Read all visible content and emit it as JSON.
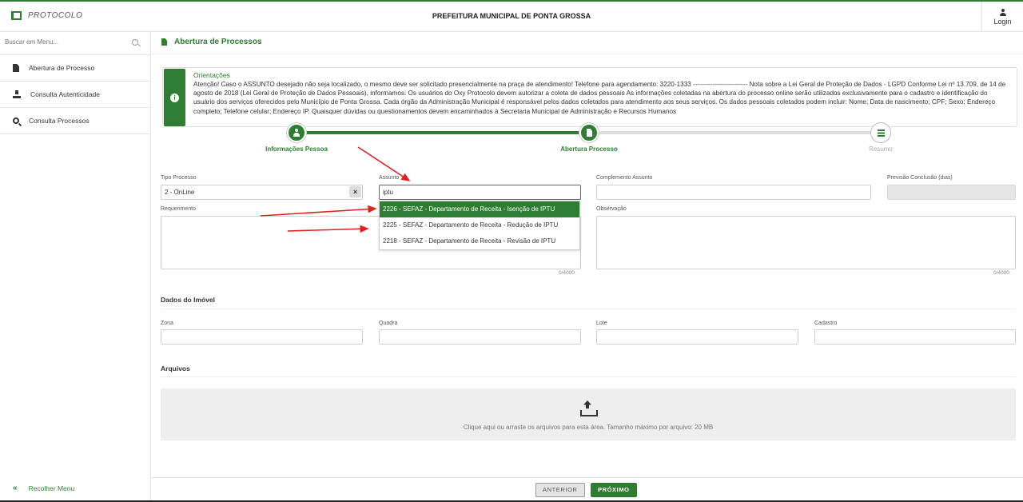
{
  "header": {
    "brand": "PROTOCOLO",
    "title": "PREFEITURA MUNICIPAL DE PONTA GROSSA",
    "login_label": "Login"
  },
  "sidebar": {
    "search_placeholder": "Buscar em Menu...",
    "items": [
      {
        "label": "Abertura de Processo",
        "icon": "file-icon"
      },
      {
        "label": "Consulta Autenticidade",
        "icon": "download-icon"
      },
      {
        "label": "Consulta Processos",
        "icon": "search-icon"
      }
    ],
    "collapse_label": "Recolher Menu"
  },
  "page": {
    "title": "Abertura de Processos"
  },
  "notice": {
    "title": "Orientações",
    "text": "Atenção! Caso o ASSUNTO desejado não seja localizado, o mesmo deve ser solicitado presencialmente na praça de atendimento! Telefone para agendamento: 3220-1333 ------------------------- Nota sobre a Lei Geral de Proteção de Dados - LGPD Conforme Lei nº 13.709, de 14 de agosto de 2018 (Lei Geral de Proteção de Dados Pessoais), informamos: Os usuários do Oxy Protocolo devem autorizar a coleta de dados pessoais As informações coletadas na abertura do processo online serão utilizados exclusivamente para o cadastro e identificação do usuário dos serviços oferecidos pelo Município de Ponta Grossa. Cada órgão da Administração Municipal é responsável pelos dados coletados para atendimento aos seus serviços. Os dados pessoais coletados podem incluir: Nome; Data de nascimento; CPF; Sexo; Endereço completo; Telefone celular; Endereço IP. Quaisquer dúvidas ou questionamentos devem encaminhados à Secretaria Municipal de Administração e Recursos Humanos"
  },
  "steps": [
    {
      "label": "Informações Pessoa",
      "state": "done"
    },
    {
      "label": "Abertura Processo",
      "state": "done"
    },
    {
      "label": "Resumo",
      "state": "pending"
    }
  ],
  "form": {
    "tipo_processo": {
      "label": "Tipo Processo",
      "value": "2 - OnLine",
      "clear": "×"
    },
    "assunto": {
      "label": "Assunto",
      "value": "iptu"
    },
    "complemento": {
      "label": "Complemento Assunto",
      "value": ""
    },
    "previsao": {
      "label": "Previsão Conclusão (dias)",
      "value": ""
    },
    "requerimento": {
      "label": "Requerimento",
      "counter": "0/4000"
    },
    "observacao": {
      "label": "Observação",
      "counter": "0/4000"
    },
    "assunto_options": [
      "2226 - SEFAZ - Departamento de Receita - Isenção de IPTU",
      "2225 - SEFAZ - Departamento de Receita - Redução de IPTU",
      "2218 - SEFAZ - Departamento de Receita - Revisão de IPTU"
    ]
  },
  "imovel": {
    "title": "Dados do Imóvel",
    "zona": "Zona",
    "quadra": "Quadra",
    "lote": "Lote",
    "cadastro": "Cadastro"
  },
  "arquivos": {
    "title": "Arquivos",
    "upload_text": "Clique aqui ou arraste os arquivos para esta área. Tamanho máximo por arquivo: 20 MB"
  },
  "footer": {
    "prev": "ANTERIOR",
    "next": "PRÓXIMO"
  },
  "colors": {
    "accent": "#2e7d32",
    "annotation_arrow": "#e0201c"
  }
}
